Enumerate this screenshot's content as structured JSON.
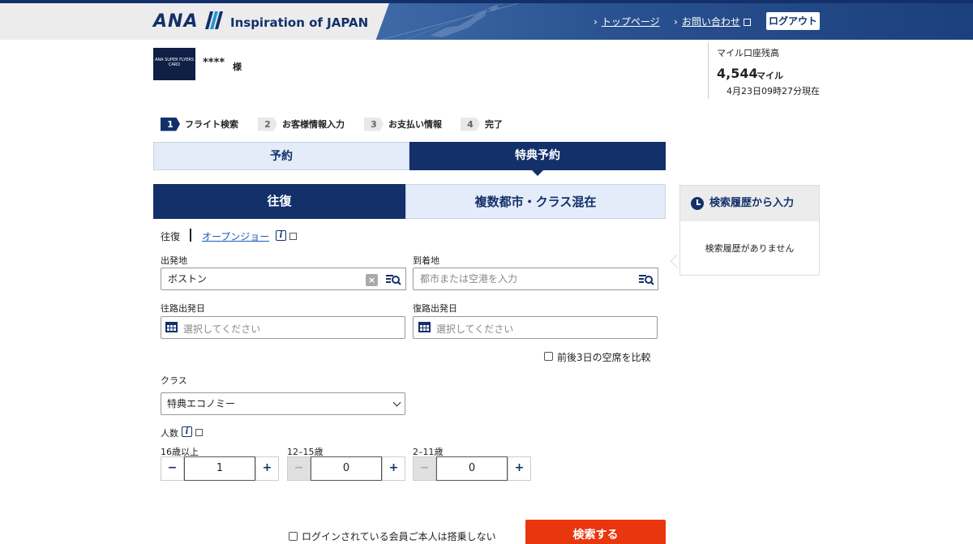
{
  "header": {
    "logo_text": "ANA",
    "tagline": "Inspiration of JAPAN",
    "nav": {
      "top_page": "トップページ",
      "contact": "お問い合わせ",
      "logout": "ログアウト"
    }
  },
  "member": {
    "card_text": "ANA SUPER FLYERS CARD",
    "name": "****",
    "suffix": "様",
    "miles_label": "マイル口座残高",
    "miles_value": "4,544",
    "miles_unit": "マイル",
    "as_of": "4月23日09時27分現在"
  },
  "steps": [
    {
      "num": "1",
      "label": "フライト検索",
      "active": true
    },
    {
      "num": "2",
      "label": "お客様情報入力",
      "active": false
    },
    {
      "num": "3",
      "label": "お支払い情報",
      "active": false
    },
    {
      "num": "4",
      "label": "完了",
      "active": false
    }
  ],
  "tabs": {
    "booking": "予約",
    "award": "特典予約"
  },
  "subtabs": {
    "round_trip": "往復",
    "multi_city": "複数都市・クラス混在"
  },
  "trip_type": {
    "round_trip": "往復",
    "open_jaw": "オープンジョー"
  },
  "form": {
    "origin_label": "出発地",
    "origin_value": "ボストン",
    "destination_label": "到着地",
    "destination_placeholder": "都市または空港を入力",
    "depart_label": "往路出発日",
    "depart_placeholder": "選択してください",
    "return_label": "復路出発日",
    "return_placeholder": "選択してください",
    "compare_label": "前後3日の空席を比較",
    "class_label": "クラス",
    "class_value": "特典エコノミー",
    "pax_label": "人数",
    "adult_label": "16歳以上",
    "adult_value": "1",
    "youth_label": "12–15歳",
    "youth_value": "0",
    "child_label": "2–11歳",
    "child_value": "0",
    "not_boarding_label": "ログインされている会員ご本人は搭乗しない",
    "submit": "検索する"
  },
  "history": {
    "title": "検索履歴から入力",
    "empty": "検索履歴がありません"
  },
  "colors": {
    "navy": "#13306b",
    "accent_red": "#e8360e",
    "light_blue": "#e3ecf8"
  }
}
